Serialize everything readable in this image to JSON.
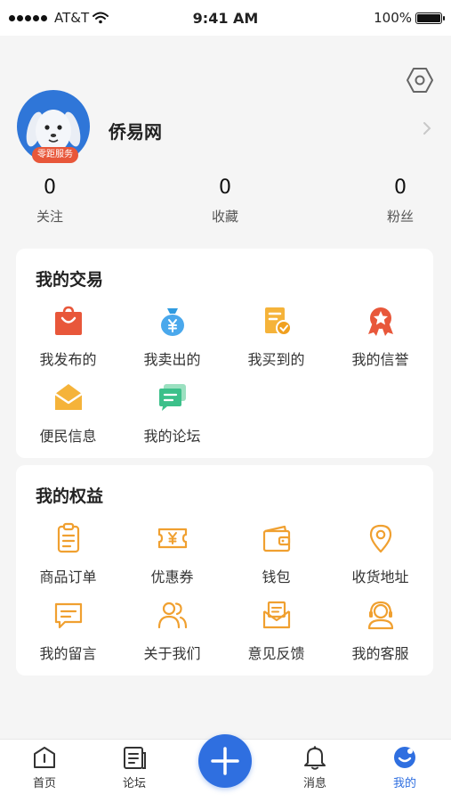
{
  "status_bar": {
    "carrier": "AT&T",
    "time": "9:41 AM",
    "battery": "100%"
  },
  "profile": {
    "name": "侨易网",
    "badge": "零距服务"
  },
  "stats": [
    {
      "value": "0",
      "label": "关注"
    },
    {
      "value": "0",
      "label": "收藏"
    },
    {
      "value": "0",
      "label": "粉丝"
    }
  ],
  "trade": {
    "title": "我的交易",
    "items": [
      {
        "label": "我发布的",
        "icon": "shopping-bag-icon"
      },
      {
        "label": "我卖出的",
        "icon": "money-bag-icon"
      },
      {
        "label": "我买到的",
        "icon": "purchase-receipt-icon"
      },
      {
        "label": "我的信誉",
        "icon": "award-medal-icon"
      },
      {
        "label": "便民信息",
        "icon": "envelope-icon"
      },
      {
        "label": "我的论坛",
        "icon": "chat-bubbles-icon"
      }
    ]
  },
  "rights": {
    "title": "我的权益",
    "items": [
      {
        "label": "商品订单",
        "icon": "clipboard-icon"
      },
      {
        "label": "优惠券",
        "icon": "coupon-icon"
      },
      {
        "label": "钱包",
        "icon": "wallet-icon"
      },
      {
        "label": "收货地址",
        "icon": "location-pin-icon"
      },
      {
        "label": "我的留言",
        "icon": "message-icon"
      },
      {
        "label": "关于我们",
        "icon": "people-icon"
      },
      {
        "label": "意见反馈",
        "icon": "feedback-mail-icon"
      },
      {
        "label": "我的客服",
        "icon": "customer-service-icon"
      }
    ]
  },
  "tabbar": {
    "items": [
      {
        "label": "首页",
        "icon": "home-icon"
      },
      {
        "label": "论坛",
        "icon": "forum-icon"
      },
      {
        "label": "消息",
        "icon": "bell-icon"
      },
      {
        "label": "我的",
        "icon": "profile-face-icon",
        "active": true
      }
    ],
    "center_icon": "plus-icon"
  },
  "colors": {
    "accent": "#2f6fe0",
    "avatar_bg": "#2f76d8",
    "orange": "#f5a623",
    "red": "#e8573a",
    "green": "#3cc08a",
    "icon_outline": "#f0a030"
  }
}
